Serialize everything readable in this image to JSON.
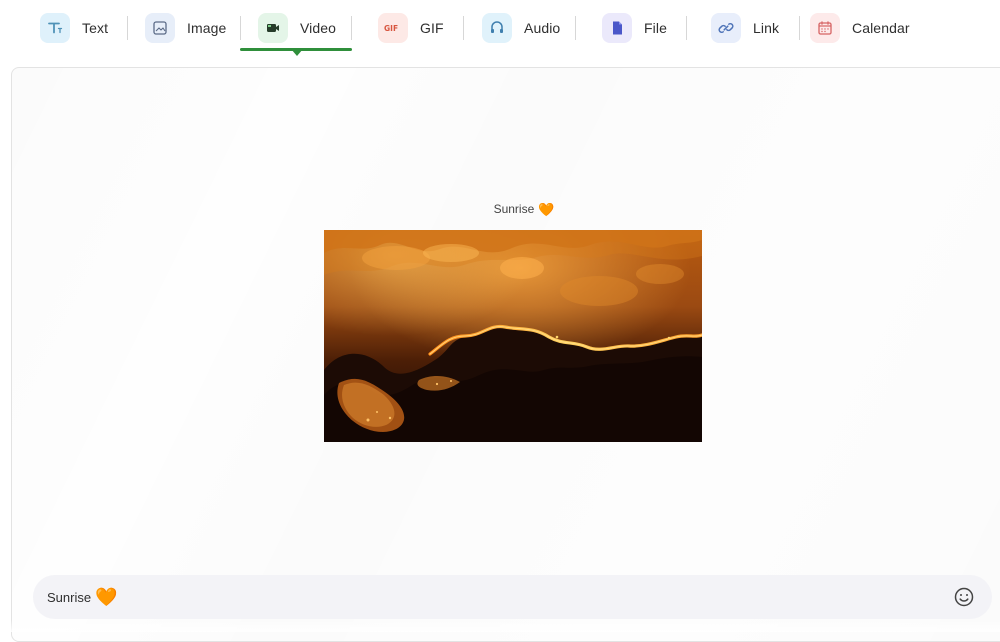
{
  "tabs": [
    {
      "label": "Text",
      "icon": "text-icon",
      "color": "#dff1fb"
    },
    {
      "label": "Image",
      "icon": "image-icon",
      "color": "#e7eef9"
    },
    {
      "label": "Video",
      "icon": "video-icon",
      "color": "#e4f5e8",
      "active": true
    },
    {
      "label": "GIF",
      "icon": "gif-icon",
      "color": "#fde9e6"
    },
    {
      "label": "Audio",
      "icon": "audio-icon",
      "color": "#e0f2fb"
    },
    {
      "label": "File",
      "icon": "file-icon",
      "color": "#ebe9fb"
    },
    {
      "label": "Link",
      "icon": "link-icon",
      "color": "#e8eefb"
    },
    {
      "label": "Calendar",
      "icon": "calendar-icon",
      "color": "#fdeaea"
    }
  ],
  "preview": {
    "title": "Sunrise",
    "heart": "🧡"
  },
  "composer": {
    "value": "Sunrise",
    "heart": "🧡",
    "emoji_icon": "smiley-icon"
  },
  "colors": {
    "active": "#2f8f3b",
    "heart": "#ef6c2f"
  }
}
